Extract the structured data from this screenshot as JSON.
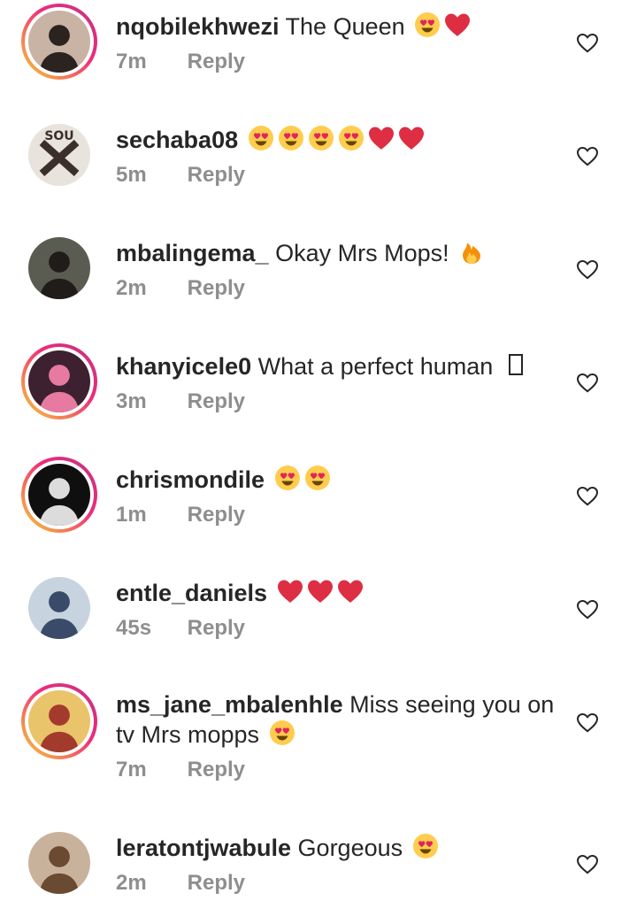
{
  "comments": [
    {
      "username": "nqobilekhwezi",
      "text": "The Queen",
      "emojis": [
        "heart-eyes-icon",
        "red-heart-icon"
      ],
      "time": "7m",
      "reply": "Reply",
      "ring": true,
      "avatar_bg": "#c9b3a4",
      "avatar_fg": "#2a2320"
    },
    {
      "username": "sechaba08",
      "text": "",
      "emojis": [
        "heart-eyes-icon",
        "heart-eyes-icon",
        "heart-eyes-icon",
        "heart-eyes-icon",
        "red-heart-icon",
        "red-heart-icon"
      ],
      "time": "5m",
      "reply": "Reply",
      "ring": false,
      "avatar_bg": "#e8e3dc",
      "avatar_fg": "#3b2f2a",
      "avatar_label": "SOU"
    },
    {
      "username": "mbalingema_",
      "text": "Okay Mrs Mops!",
      "emojis": [
        "fire-icon"
      ],
      "time": "2m",
      "reply": "Reply",
      "ring": false,
      "avatar_bg": "#5a5c52",
      "avatar_fg": "#201c1a"
    },
    {
      "username": "khanyicele0",
      "text": "What a perfect human",
      "emojis": [
        "missing-glyph-icon"
      ],
      "time": "3m",
      "reply": "Reply",
      "ring": true,
      "avatar_bg": "#3d2130",
      "avatar_fg": "#e77aa0"
    },
    {
      "username": "chrismondile",
      "text": "",
      "emojis": [
        "heart-eyes-icon",
        "heart-eyes-icon"
      ],
      "time": "1m",
      "reply": "Reply",
      "ring": true,
      "avatar_bg": "#0f0f0f",
      "avatar_fg": "#dcdcdc"
    },
    {
      "username": "entle_daniels",
      "text": "",
      "emojis": [
        "red-heart-icon",
        "red-heart-icon",
        "red-heart-icon"
      ],
      "time": "45s",
      "reply": "Reply",
      "ring": false,
      "avatar_bg": "#c7d3de",
      "avatar_fg": "#3a4b6a"
    },
    {
      "username": "ms_jane_mbalenhle",
      "text": "Miss seeing you on",
      "text2": "tv Mrs mopps",
      "emojis": [
        "heart-eyes-icon"
      ],
      "time": "7m",
      "reply": "Reply",
      "ring": true,
      "avatar_bg": "#e9c46a",
      "avatar_fg": "#a33b2d"
    },
    {
      "username": "leratontjwabule",
      "text": "Gorgeous",
      "emojis": [
        "heart-eyes-icon"
      ],
      "time": "2m",
      "reply": "Reply",
      "ring": false,
      "avatar_bg": "#c9b29b",
      "avatar_fg": "#6b4a32"
    }
  ],
  "colors": {
    "text": "#262626",
    "meta": "#8e8e8e",
    "ring_start": "#f9ce34",
    "ring_end": "#c13584"
  }
}
